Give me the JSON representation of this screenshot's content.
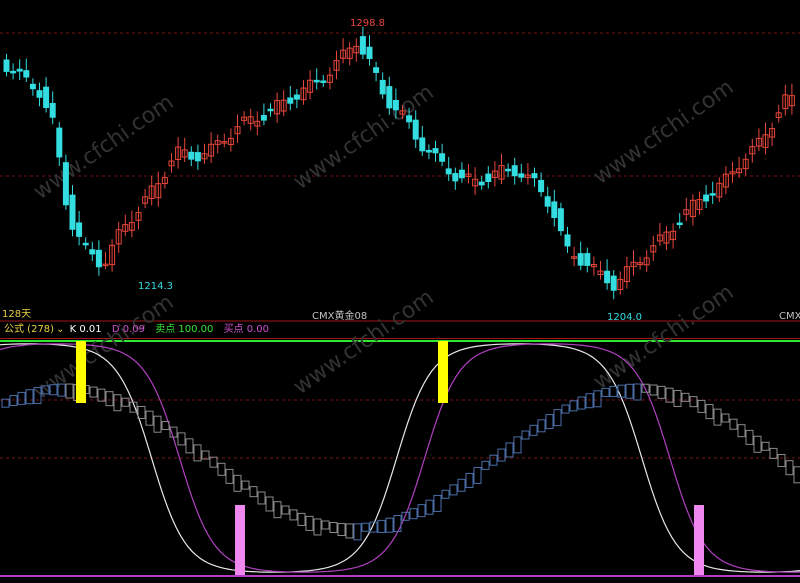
{
  "price_panel": {
    "high_label": "1298.8",
    "low_label_1": "1214.3",
    "low_label_2": "1204.0",
    "period_label": "128天",
    "contract_label": "CMX黄金08",
    "contract_label_right": "CMX黄"
  },
  "indicator_bar": {
    "formula_label": "公式 (278)",
    "dropdown_icon": "chevron-down-icon",
    "k_label": "K 0.01",
    "d_label": "D 0.09",
    "sell_label": "卖点 100.00",
    "buy_label": "买点 0.00"
  },
  "watermark": "www.cfchi.com",
  "colors": {
    "bull": "#e8463b",
    "bear": "#33dde0",
    "k_line": "#e8e8e8",
    "d_line": "#b040c0",
    "sell_marker": "#ffff00",
    "buy_marker": "#ee88ee",
    "top_line": "#32e632",
    "bottom_line": "#b040c0",
    "grid": "#7a1010",
    "formula": "#e8d040",
    "k_text": "#ffffff",
    "d_text": "#d050d0",
    "sell_text": "#32e632",
    "buy_text": "#d050d0"
  }
}
